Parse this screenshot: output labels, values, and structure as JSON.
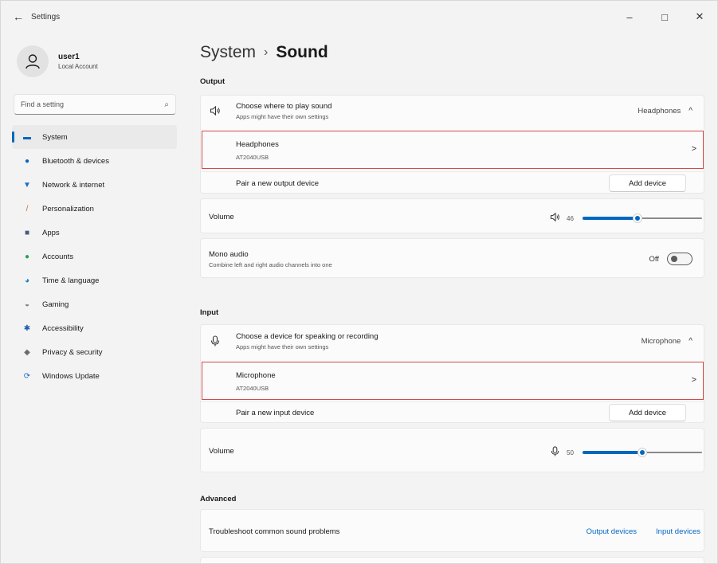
{
  "window": {
    "title": "Settings",
    "back_icon": "←",
    "minimize_icon": "–",
    "maximize_icon": "□",
    "close_icon": "✕"
  },
  "profile": {
    "name": "user1",
    "account_type": "Local Account"
  },
  "search": {
    "placeholder": "Find a setting",
    "icon": "⌕"
  },
  "sidebar": {
    "items": [
      {
        "label": "System",
        "icon": "▬",
        "color": "#0067c0",
        "active": true
      },
      {
        "label": "Bluetooth & devices",
        "icon": "●",
        "color": "#0067c0",
        "active": false
      },
      {
        "label": "Network & internet",
        "icon": "▼",
        "color": "#1e6fc6",
        "active": false
      },
      {
        "label": "Personalization",
        "icon": "/",
        "color": "#c96b2e",
        "active": false
      },
      {
        "label": "Apps",
        "icon": "■",
        "color": "#4a5a7a",
        "active": false
      },
      {
        "label": "Accounts",
        "icon": "●",
        "color": "#2e9e57",
        "active": false
      },
      {
        "label": "Time & language",
        "icon": "◕",
        "color": "#1e88c6",
        "active": false
      },
      {
        "label": "Gaming",
        "icon": "◒",
        "color": "#7a7a7a",
        "active": false
      },
      {
        "label": "Accessibility",
        "icon": "✱",
        "color": "#1a5dab",
        "active": false
      },
      {
        "label": "Privacy & security",
        "icon": "◆",
        "color": "#6b6b6b",
        "active": false
      },
      {
        "label": "Windows Update",
        "icon": "⟳",
        "color": "#1e6fc6",
        "active": false
      }
    ]
  },
  "breadcrumb": {
    "parent": "System",
    "separator": "›",
    "current": "Sound"
  },
  "output": {
    "section_title": "Output",
    "choose_title": "Choose where to play sound",
    "choose_sub": "Apps might have their own settings",
    "choose_value": "Headphones",
    "chevron_up": "^",
    "device_name": "Headphones",
    "device_model": "AT2040USB",
    "device_chevron": ">",
    "pair_label": "Pair a new output device",
    "add_button": "Add device",
    "volume_label": "Volume",
    "volume_value": "46",
    "volume_percent": 46,
    "mono_title": "Mono audio",
    "mono_sub": "Combine left and right audio channels into one",
    "mono_state": "Off"
  },
  "input": {
    "section_title": "Input",
    "choose_title": "Choose a device for speaking or recording",
    "choose_sub": "Apps might have their own settings",
    "choose_value": "Microphone",
    "chevron_up": "^",
    "device_name": "Microphone",
    "device_model": "AT2040USB",
    "device_chevron": ">",
    "pair_label": "Pair a new input device",
    "add_button": "Add device",
    "volume_label": "Volume",
    "volume_value": "50",
    "volume_percent": 50
  },
  "advanced": {
    "section_title": "Advanced",
    "troubleshoot_label": "Troubleshoot common sound problems",
    "output_link": "Output devices",
    "input_link": "Input devices"
  },
  "colors": {
    "accent": "#0067c0",
    "highlight_border": "#d44a4a"
  }
}
